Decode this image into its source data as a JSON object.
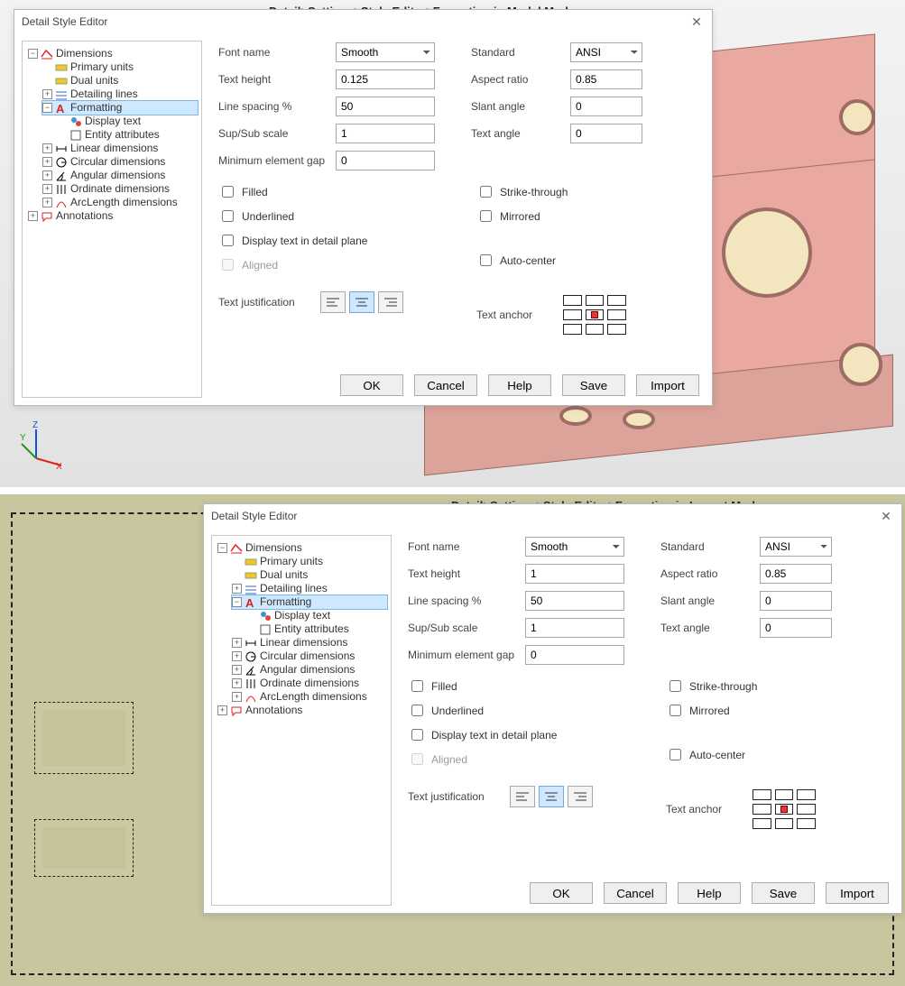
{
  "dialog_title": "Detail Style Editor",
  "breadcrumb_top": "Detail>Settings>Style Editor>Formating in Model Mode",
  "breadcrumb_bottom": "Detail>Settings>Style Editor>Formating in Layout Mode",
  "tree": {
    "dimensions": "Dimensions",
    "primary_units": "Primary units",
    "dual_units": "Dual units",
    "detailing_lines": "Detailing lines",
    "formatting": "Formatting",
    "display_text": "Display text",
    "entity_attributes": "Entity attributes",
    "linear": "Linear dimensions",
    "circular": "Circular dimensions",
    "angular": "Angular dimensions",
    "ordinate": "Ordinate dimensions",
    "arclength": "ArcLength dimensions",
    "annotations": "Annotations"
  },
  "labels": {
    "font_name": "Font name",
    "text_height": "Text height",
    "line_spacing": "Line spacing %",
    "sup_sub": "Sup/Sub scale",
    "min_gap": "Minimum element gap",
    "standard": "Standard",
    "aspect_ratio": "Aspect ratio",
    "slant_angle": "Slant angle",
    "text_angle": "Text angle",
    "filled": "Filled",
    "underlined": "Underlined",
    "disp_detail_plane": "Display text in detail plane",
    "aligned": "Aligned",
    "strike": "Strike-through",
    "mirrored": "Mirrored",
    "auto_center": "Auto-center",
    "text_just": "Text justification",
    "text_anchor": "Text anchor"
  },
  "values_top": {
    "font_name": "Smooth",
    "text_height": "0.125",
    "line_spacing": "50",
    "sup_sub": "1",
    "min_gap": "0",
    "standard": "ANSI",
    "aspect_ratio": "0.85",
    "slant_angle": "0",
    "text_angle": "0"
  },
  "values_bottom": {
    "font_name": "Smooth",
    "text_height": "1",
    "line_spacing": "50",
    "sup_sub": "1",
    "min_gap": "0",
    "standard": "ANSI",
    "aspect_ratio": "0.85",
    "slant_angle": "0",
    "text_angle": "0"
  },
  "buttons": {
    "ok": "OK",
    "cancel": "Cancel",
    "help": "Help",
    "save": "Save",
    "import": "Import"
  },
  "axes": {
    "x": "X",
    "y": "Y",
    "z": "Z"
  }
}
